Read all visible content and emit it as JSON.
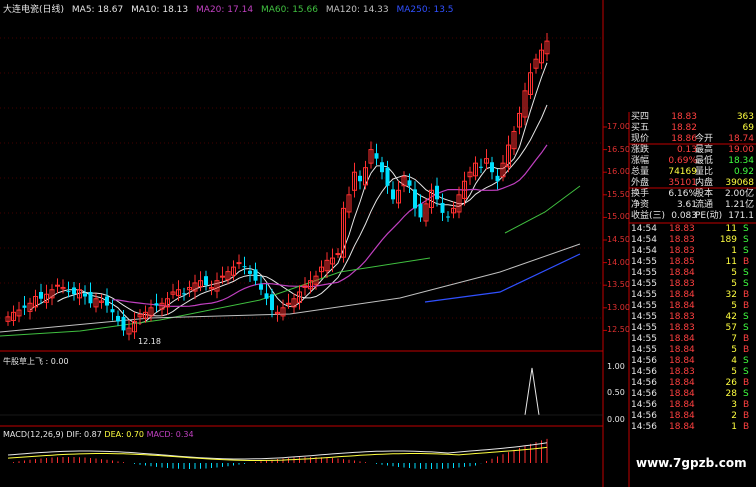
{
  "header": {
    "title": "大连电瓷(日线)",
    "ma": [
      {
        "label": "MA5: 18.67",
        "color": "#e6e6e6"
      },
      {
        "label": "MA10: 18.13",
        "color": "#e6e6e6"
      },
      {
        "label": "MA20: 17.14",
        "color": "#c040c0"
      },
      {
        "label": "MA60: 15.66",
        "color": "#40c040"
      },
      {
        "label": "MA120: 14.33",
        "color": "#c0c0c0"
      },
      {
        "label": "MA250: 13.5",
        "color": "#3050ff"
      }
    ]
  },
  "price_axis": {
    "ticks": [
      "17.00",
      "16.50",
      "16.00",
      "15.50",
      "15.00",
      "14.50",
      "14.00",
      "13.50",
      "13.00",
      "12.50"
    ]
  },
  "low_marker": "12.18",
  "indicator1": {
    "label": "牛股草上飞 : 0.00",
    "ticks": [
      "1.00",
      "0.50",
      "0.00"
    ]
  },
  "macd": {
    "label_prefix": "MACD(12,26,9)",
    "dif": "DIF: 0.87",
    "dea": "DEA: 0.70",
    "macd": "MACD: 0.34"
  },
  "quote": {
    "rows": [
      {
        "l": "买四",
        "v": "18.83",
        "vc": "#ff4040",
        "r": "",
        "rv": "363",
        "rvc": "#ffff40"
      },
      {
        "l": "买五",
        "v": "18.82",
        "vc": "#ff4040",
        "r": "",
        "rv": "69",
        "rvc": "#ffff40"
      },
      {
        "l": "现价",
        "v": "18.86",
        "vc": "#ff4040",
        "r": "今开",
        "rv": "18.74",
        "rvc": "#ff4040"
      },
      {
        "l": "涨跌",
        "v": "0.13",
        "vc": "#ff4040",
        "r": "最高",
        "rv": "19.00",
        "rvc": "#ff4040"
      },
      {
        "l": "涨幅",
        "v": "0.69%",
        "vc": "#ff4040",
        "r": "最低",
        "rv": "18.34",
        "rvc": "#40ff40"
      },
      {
        "l": "总量",
        "v": "74169",
        "vc": "#ffff40",
        "r": "量比",
        "rv": "0.92",
        "rvc": "#40ff40"
      },
      {
        "l": "外盘",
        "v": "35101",
        "vc": "#ff4040",
        "r": "内盘",
        "rv": "39068",
        "rvc": "#ffff40"
      },
      {
        "l": "换手",
        "v": "6.16%",
        "vc": "#e6e6e6",
        "r": "股本",
        "rv": "2.00亿",
        "rvc": "#e6e6e6"
      },
      {
        "l": "净资",
        "v": "3.61",
        "vc": "#e6e6e6",
        "r": "流通",
        "rv": "1.21亿",
        "rvc": "#e6e6e6"
      },
      {
        "l": "收益(三)",
        "v": "0.083",
        "vc": "#e6e6e6",
        "r": "PE(动)",
        "rv": "171.1",
        "rvc": "#e6e6e6"
      }
    ],
    "trades": [
      {
        "t": "14:54",
        "p": "18.83",
        "v": "11",
        "s": "S"
      },
      {
        "t": "14:54",
        "p": "18.83",
        "v": "189",
        "s": "S"
      },
      {
        "t": "14:54",
        "p": "18.83",
        "v": "1",
        "s": "S"
      },
      {
        "t": "14:55",
        "p": "18.85",
        "v": "11",
        "s": "B"
      },
      {
        "t": "14:55",
        "p": "18.84",
        "v": "5",
        "s": "S"
      },
      {
        "t": "14:55",
        "p": "18.83",
        "v": "5",
        "s": "S"
      },
      {
        "t": "14:55",
        "p": "18.84",
        "v": "32",
        "s": "B"
      },
      {
        "t": "14:55",
        "p": "18.84",
        "v": "5",
        "s": "B"
      },
      {
        "t": "14:55",
        "p": "18.83",
        "v": "42",
        "s": "S"
      },
      {
        "t": "14:55",
        "p": "18.83",
        "v": "57",
        "s": "S"
      },
      {
        "t": "14:55",
        "p": "18.84",
        "v": "7",
        "s": "B"
      },
      {
        "t": "14:55",
        "p": "18.84",
        "v": "5",
        "s": "B"
      },
      {
        "t": "14:56",
        "p": "18.84",
        "v": "4",
        "s": "S"
      },
      {
        "t": "14:56",
        "p": "18.83",
        "v": "5",
        "s": "S"
      },
      {
        "t": "14:56",
        "p": "18.84",
        "v": "26",
        "s": "B"
      },
      {
        "t": "14:56",
        "p": "18.84",
        "v": "28",
        "s": "S"
      },
      {
        "t": "14:56",
        "p": "18.84",
        "v": "3",
        "s": "B"
      },
      {
        "t": "14:56",
        "p": "18.84",
        "v": "2",
        "s": "B"
      },
      {
        "t": "14:56",
        "p": "18.84",
        "v": "1",
        "s": "B"
      }
    ]
  },
  "watermark": "www.7gpzb.com",
  "colors": {
    "up": "#ff3030",
    "down": "#00e0ff",
    "ma5": "#e6e6e6",
    "ma10": "#e6e6e6",
    "ma20": "#c040c0",
    "ma60": "#40c040",
    "ma120": "#c0c0c0",
    "ma250": "#3050ff",
    "axis": "#c00000",
    "sell": "#40ff40",
    "buy": "#ff4040"
  }
}
